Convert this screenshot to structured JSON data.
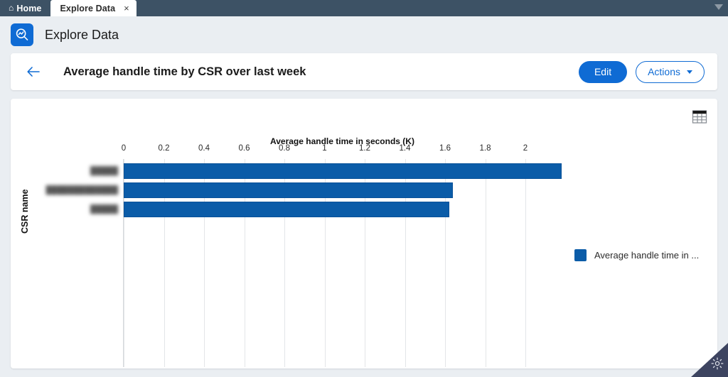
{
  "window": {
    "tabs": [
      {
        "label": "Home",
        "icon": "home-icon",
        "active": false,
        "closable": false
      },
      {
        "label": "Explore Data",
        "icon": null,
        "active": true,
        "closable": true,
        "close_glyph": "×"
      }
    ],
    "overflow_icon": "chevron-down-icon"
  },
  "app_header": {
    "icon": "explore-data-icon",
    "title": "Explore Data"
  },
  "view_header": {
    "back_icon": "arrow-left-icon",
    "title": "Average handle time by CSR over last week",
    "edit_label": "Edit",
    "actions_label": "Actions",
    "actions_caret_icon": "caret-down-icon"
  },
  "chart_card": {
    "table_toggle_icon": "table-icon"
  },
  "status_bar": {
    "settings_icon": "gear-icon"
  },
  "colors": {
    "accent": "#0f6bd4",
    "bar": "#0b5ca8",
    "tab_strip": "#3d5265",
    "page_bg": "#eaeef2",
    "corner": "#3d4460"
  },
  "chart_data": {
    "type": "bar",
    "orientation": "horizontal",
    "title": "",
    "xlabel": "Average handle time in seconds (K)",
    "ylabel": "CSR name",
    "categories": [
      "█████",
      "█████████████",
      "█████"
    ],
    "category_labels_redacted": true,
    "values": [
      2.18,
      1.64,
      1.62
    ],
    "xlim": [
      0,
      2.18
    ],
    "x_ticks": [
      "0",
      "0.2",
      "0.4",
      "0.6",
      "0.8",
      "1",
      "1.2",
      "1.4",
      "1.6",
      "1.8",
      "2"
    ],
    "x_tick_values": [
      0,
      0.2,
      0.4,
      0.6,
      0.8,
      1,
      1.2,
      1.4,
      1.6,
      1.8,
      2
    ],
    "grid": true,
    "legend_position": "right",
    "legend": [
      {
        "label": "Average handle time in ...",
        "color": "#0b5ca8"
      }
    ]
  }
}
